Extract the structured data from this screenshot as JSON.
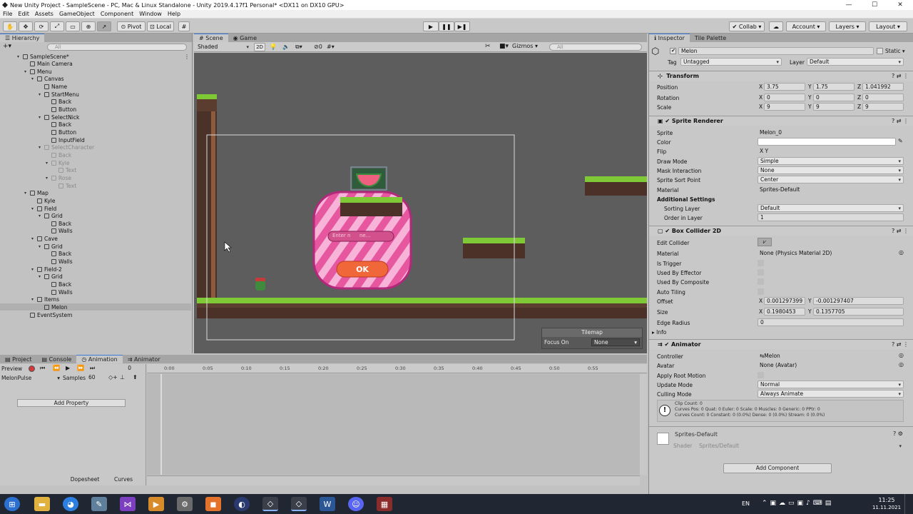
{
  "window": {
    "title": "New Unity Project - SampleScene - PC, Mac & Linux Standalone - Unity 2019.4.17f1 Personal* <DX11 on DX10 GPU>"
  },
  "menu": [
    "File",
    "Edit",
    "Assets",
    "GameObject",
    "Component",
    "Window",
    "Help"
  ],
  "toolbar": {
    "pivot": "Pivot",
    "local": "Local",
    "collab": "Collab",
    "account": "Account",
    "layers": "Layers",
    "layout": "Layout"
  },
  "hierarchy": {
    "tab": "Hierarchy",
    "search_placeholder": "All",
    "items": [
      {
        "label": "SampleScene*",
        "depth": 0
      },
      {
        "label": "Main Camera",
        "depth": 1
      },
      {
        "label": "Menu",
        "depth": 1
      },
      {
        "label": "Canvas",
        "depth": 2
      },
      {
        "label": "Name",
        "depth": 3
      },
      {
        "label": "StartMenu",
        "depth": 3
      },
      {
        "label": "Back",
        "depth": 4
      },
      {
        "label": "Button",
        "depth": 4
      },
      {
        "label": "SelectNick",
        "depth": 3
      },
      {
        "label": "Back",
        "depth": 4
      },
      {
        "label": "Button",
        "depth": 4
      },
      {
        "label": "InputField",
        "depth": 4
      },
      {
        "label": "SelectCharacter",
        "depth": 3
      },
      {
        "label": "Back",
        "depth": 4
      },
      {
        "label": "Kyle",
        "depth": 4
      },
      {
        "label": "Text",
        "depth": 5
      },
      {
        "label": "Rose",
        "depth": 4
      },
      {
        "label": "Text",
        "depth": 5
      },
      {
        "label": "Map",
        "depth": 1
      },
      {
        "label": "Kyle",
        "depth": 2
      },
      {
        "label": "Field",
        "depth": 2
      },
      {
        "label": "Grid",
        "depth": 3
      },
      {
        "label": "Back",
        "depth": 4
      },
      {
        "label": "Walls",
        "depth": 4
      },
      {
        "label": "Cave",
        "depth": 2
      },
      {
        "label": "Grid",
        "depth": 3
      },
      {
        "label": "Back",
        "depth": 4
      },
      {
        "label": "Walls",
        "depth": 4
      },
      {
        "label": "Field-2",
        "depth": 2
      },
      {
        "label": "Grid",
        "depth": 3
      },
      {
        "label": "Back",
        "depth": 4
      },
      {
        "label": "Walls",
        "depth": 4
      },
      {
        "label": "Items",
        "depth": 2
      },
      {
        "label": "Melon",
        "depth": 3
      },
      {
        "label": "EventSystem",
        "depth": 1
      }
    ]
  },
  "scene": {
    "tabs": [
      "Scene",
      "Game"
    ],
    "shading": "Shaded",
    "mode2d": "2D",
    "fx_count": "0",
    "gizmos": "Gizmos",
    "search_placeholder": "All",
    "input_placeholder": "Enter n",
    "input_placeholder_tail": "ne...",
    "ok_label": "OK",
    "tilemap": {
      "title": "Tilemap",
      "focus_label": "Focus On",
      "focus_value": "None"
    }
  },
  "bottom": {
    "tabs": [
      "Project",
      "Console",
      "Animation",
      "Animator"
    ],
    "preview": "Preview",
    "frame": "0",
    "clip": "MelonPulse",
    "samples_label": "Samples",
    "samples": "60",
    "add_property": "Add Property",
    "ticks": [
      "0:00",
      "0:05",
      "0:10",
      "0:15",
      "0:20",
      "0:25",
      "0:30",
      "0:35",
      "0:40",
      "0:45",
      "0:50",
      "0:55"
    ],
    "dopesheet": "Dopesheet",
    "curves": "Curves"
  },
  "inspector": {
    "tabs": [
      "Inspector",
      "Tile Palette"
    ],
    "object_name": "Melon",
    "static": "Static",
    "tag_label": "Tag",
    "tag": "Untagged",
    "layer_label": "Layer",
    "layer": "Default",
    "transform": {
      "title": "Transform",
      "position": {
        "label": "Position",
        "x": "3.75",
        "y": "1.75",
        "z": "1.041992"
      },
      "rotation": {
        "label": "Rotation",
        "x": "0",
        "y": "0",
        "z": "0"
      },
      "scale": {
        "label": "Scale",
        "x": "9",
        "y": "9",
        "z": "9"
      }
    },
    "sprite_renderer": {
      "title": "Sprite Renderer",
      "rows": [
        {
          "label": "Sprite",
          "value": "Melon_0"
        },
        {
          "label": "Color",
          "value": ""
        },
        {
          "label": "Flip",
          "value": "X    Y"
        },
        {
          "label": "Draw Mode",
          "value": "Simple"
        },
        {
          "label": "Mask Interaction",
          "value": "None"
        },
        {
          "label": "Sprite Sort Point",
          "value": "Center"
        },
        {
          "label": "Material",
          "value": "Sprites-Default"
        }
      ],
      "additional": "Additional Settings",
      "sorting_layer_label": "Sorting Layer",
      "sorting_layer": "Default",
      "order_label": "Order in Layer",
      "order": "1"
    },
    "box_collider": {
      "title": "Box Collider 2D",
      "edit": "Edit Collider",
      "material_label": "Material",
      "material": "None (Physics Material 2D)",
      "is_trigger": "Is Trigger",
      "used_by_effector": "Used By Effector",
      "used_by_composite": "Used By Composite",
      "auto_tiling": "Auto Tiling",
      "offset_label": "Offset",
      "offset_x": "0.001297399",
      "offset_y": "-0.001297407",
      "size_label": "Size",
      "size_x": "0.1980453",
      "size_y": "0.1357705",
      "edge_label": "Edge Radius",
      "edge": "0",
      "info": "Info"
    },
    "animator": {
      "title": "Animator",
      "controller_label": "Controller",
      "controller": "Melon",
      "avatar_label": "Avatar",
      "avatar": "None (Avatar)",
      "apply_root": "Apply Root Motion",
      "update_label": "Update Mode",
      "update": "Normal",
      "culling_label": "Culling Mode",
      "culling": "Always Animate",
      "info_lines": [
        "Clip Count: 0",
        "Curves Pos: 0 Quat: 0 Euler: 0 Scale: 0 Muscles: 0 Generic: 0 PPtr: 0",
        "Curves Count: 0 Constant: 0 (0.0%) Dense: 0 (0.0%) Stream: 0 (0.0%)"
      ]
    },
    "material": {
      "name": "Sprites-Default",
      "shader_label": "Shader",
      "shader": "Sprites/Default"
    },
    "add_component": "Add Component"
  },
  "taskbar": {
    "lang": "EN",
    "time": "11:25",
    "date": "11.11.2021"
  }
}
